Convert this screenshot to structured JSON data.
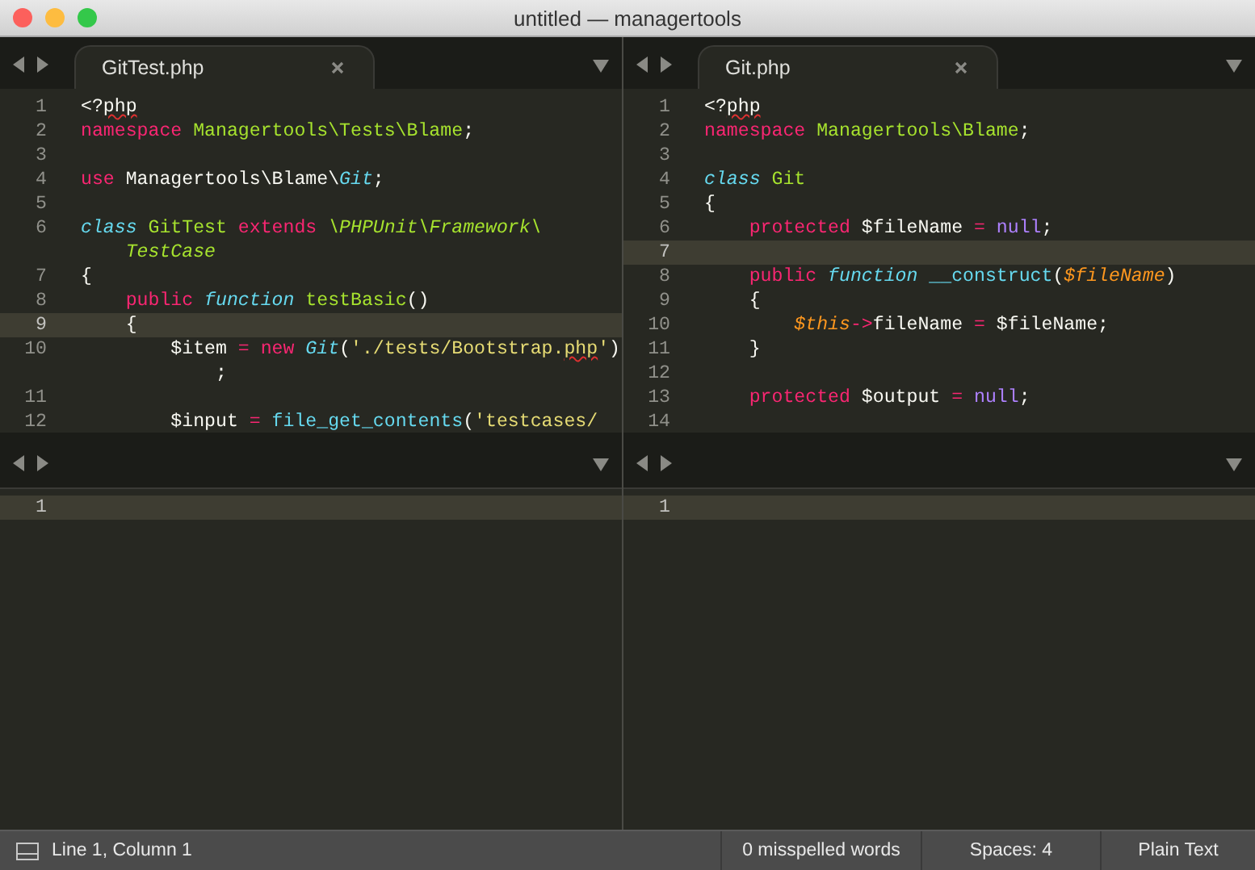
{
  "window": {
    "title": "untitled — managertools"
  },
  "panes": [
    {
      "tabs": [
        {
          "label": "GitTest.php",
          "selected": true
        }
      ],
      "lines": [
        {
          "n": "1",
          "selected": false,
          "rows": [
            [
              {
                "t": "<?",
                "kind": "plain"
              },
              {
                "t": "php",
                "kind": "plain",
                "misspelled": true
              }
            ]
          ]
        },
        {
          "n": "2",
          "selected": false,
          "rows": [
            [
              {
                "t": "namespace ",
                "kind": "keyword"
              },
              {
                "t": "Managertools\\Tests\\Blame",
                "kind": "entity"
              },
              {
                "t": ";",
                "kind": "plain"
              }
            ]
          ]
        },
        {
          "n": "3",
          "selected": false
        },
        {
          "n": "4",
          "selected": false,
          "rows": [
            [
              {
                "t": "use",
                "kind": "keyword"
              },
              {
                "t": " Managertools\\Blame\\",
                "kind": "plain"
              },
              {
                "t": "Git",
                "kind": "storage"
              },
              {
                "t": ";",
                "kind": "plain"
              }
            ]
          ]
        },
        {
          "n": "5",
          "selected": false
        },
        {
          "n": "6",
          "selected": false,
          "rows": [
            [
              {
                "t": "class ",
                "kind": "storage"
              },
              {
                "t": "GitTest ",
                "kind": "entity"
              },
              {
                "t": "extends ",
                "kind": "keyword"
              },
              {
                "t": "\\PHPUnit\\Framework\\",
                "kind": "inherited"
              }
            ],
            [
              {
                "t": "    TestCase",
                "kind": "inherited"
              }
            ]
          ]
        },
        {
          "n": "7",
          "selected": false,
          "rows": [
            [
              {
                "t": "{",
                "kind": "plain"
              }
            ]
          ]
        },
        {
          "n": "8",
          "selected": false,
          "rows": [
            [
              {
                "t": "    public ",
                "kind": "keyword"
              },
              {
                "t": "function ",
                "kind": "storage"
              },
              {
                "t": "testBasic",
                "kind": "entity"
              },
              {
                "t": "()",
                "kind": "plain"
              }
            ]
          ]
        },
        {
          "n": "9",
          "selected": true,
          "rows": [
            [
              {
                "t": "    {",
                "kind": "plain"
              }
            ]
          ]
        },
        {
          "n": "10",
          "selected": false,
          "rows": [
            [
              {
                "t": "        $item ",
                "kind": "plain"
              },
              {
                "t": "= new ",
                "kind": "keyword"
              },
              {
                "t": "Git",
                "kind": "storage"
              },
              {
                "t": "(",
                "kind": "plain"
              },
              {
                "t": "'./tests/Bootstrap.",
                "kind": "string"
              },
              {
                "t": "php",
                "kind": "string",
                "misspelled": true
              },
              {
                "t": "'",
                "kind": "string"
              },
              {
                "t": ")",
                "kind": "plain"
              }
            ],
            [
              {
                "t": "            ;",
                "kind": "plain"
              }
            ]
          ]
        },
        {
          "n": "11",
          "selected": false
        },
        {
          "n": "12",
          "selected": false,
          "rows": [
            [
              {
                "t": "        $input ",
                "kind": "plain"
              },
              {
                "t": "= ",
                "kind": "keyword"
              },
              {
                "t": "file_get_contents",
                "kind": "support"
              },
              {
                "t": "(",
                "kind": "plain"
              },
              {
                "t": "'testcases/",
                "kind": "string"
              }
            ]
          ]
        }
      ]
    },
    {
      "tabs": [
        {
          "label": "Git.php",
          "selected": true
        }
      ],
      "lines": [
        {
          "n": "1",
          "selected": false,
          "rows": [
            [
              {
                "t": "<?",
                "kind": "plain"
              },
              {
                "t": "php",
                "kind": "plain",
                "misspelled": true
              }
            ]
          ]
        },
        {
          "n": "2",
          "selected": false,
          "rows": [
            [
              {
                "t": "namespace ",
                "kind": "keyword"
              },
              {
                "t": "Managertools\\Blame",
                "kind": "entity"
              },
              {
                "t": ";",
                "kind": "plain"
              }
            ]
          ]
        },
        {
          "n": "3",
          "selected": false
        },
        {
          "n": "4",
          "selected": false,
          "rows": [
            [
              {
                "t": "class ",
                "kind": "storage"
              },
              {
                "t": "Git",
                "kind": "entity"
              }
            ]
          ]
        },
        {
          "n": "5",
          "selected": false,
          "rows": [
            [
              {
                "t": "{",
                "kind": "plain"
              }
            ]
          ]
        },
        {
          "n": "6",
          "selected": false,
          "rows": [
            [
              {
                "t": "    protected",
                "kind": "keyword"
              },
              {
                "t": " $fileName ",
                "kind": "plain"
              },
              {
                "t": "= ",
                "kind": "keyword"
              },
              {
                "t": "null",
                "kind": "constant"
              },
              {
                "t": ";",
                "kind": "plain"
              }
            ]
          ]
        },
        {
          "n": "7",
          "selected": true
        },
        {
          "n": "8",
          "selected": false,
          "rows": [
            [
              {
                "t": "    public ",
                "kind": "keyword"
              },
              {
                "t": "function ",
                "kind": "storage"
              },
              {
                "t": "__construct",
                "kind": "support"
              },
              {
                "t": "(",
                "kind": "plain"
              },
              {
                "t": "$fileName",
                "kind": "parameter"
              },
              {
                "t": ")",
                "kind": "plain"
              }
            ]
          ]
        },
        {
          "n": "9",
          "selected": false,
          "rows": [
            [
              {
                "t": "    {",
                "kind": "plain"
              }
            ]
          ]
        },
        {
          "n": "10",
          "selected": false,
          "rows": [
            [
              {
                "t": "        $this",
                "kind": "parameter"
              },
              {
                "t": "->",
                "kind": "keyword"
              },
              {
                "t": "fileName ",
                "kind": "plain"
              },
              {
                "t": "=",
                "kind": "keyword"
              },
              {
                "t": " $fileName;",
                "kind": "plain"
              }
            ]
          ]
        },
        {
          "n": "11",
          "selected": false,
          "rows": [
            [
              {
                "t": "    }",
                "kind": "plain"
              }
            ]
          ]
        },
        {
          "n": "12",
          "selected": false
        },
        {
          "n": "13",
          "selected": false,
          "rows": [
            [
              {
                "t": "    protected",
                "kind": "keyword"
              },
              {
                "t": " $output ",
                "kind": "plain"
              },
              {
                "t": "= ",
                "kind": "keyword"
              },
              {
                "t": "null",
                "kind": "constant"
              },
              {
                "t": ";",
                "kind": "plain"
              }
            ]
          ]
        },
        {
          "n": "14",
          "selected": false
        }
      ]
    },
    {
      "lines": [
        {
          "n": "1",
          "selected": true
        }
      ]
    },
    {
      "lines": [
        {
          "n": "1",
          "selected": true
        }
      ]
    }
  ],
  "status_bar": {
    "position": "Line 1, Column 1",
    "spelling": "0 misspelled words",
    "indentation": "Spaces: 4",
    "syntax": "Plain Text"
  }
}
